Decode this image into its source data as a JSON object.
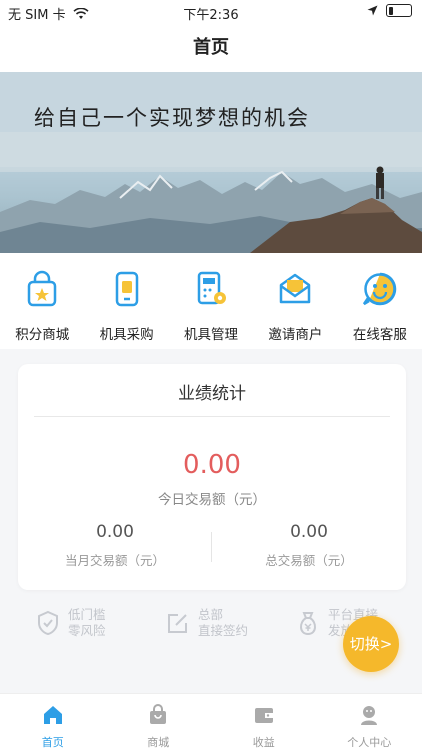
{
  "status_bar": {
    "carrier": "无 SIM 卡",
    "time": "下午2:36",
    "battery_level": 0.2
  },
  "nav": {
    "title": "首页"
  },
  "banner": {
    "slogan": "给自己一个实现梦想的机会"
  },
  "menu": [
    {
      "label": "积分商城",
      "icon": "shopping-bag-star-icon"
    },
    {
      "label": "机具采购",
      "icon": "pos-device-icon"
    },
    {
      "label": "机具管理",
      "icon": "calculator-gear-icon"
    },
    {
      "label": "邀请商户",
      "icon": "envelope-icon"
    },
    {
      "label": "在线客服",
      "icon": "smiley-face-icon"
    }
  ],
  "stats": {
    "title": "业绩统计",
    "today_value": "0.00",
    "today_label": "今日交易额（元）",
    "month_value": "0.00",
    "month_label": "当月交易额（元）",
    "total_value": "0.00",
    "total_label": "总交易额（元）"
  },
  "features": [
    {
      "line1": "低门槛",
      "line2": "零风险",
      "icon": "shield-check-icon"
    },
    {
      "line1": "总部",
      "line2": "直接签约",
      "icon": "edit-icon"
    },
    {
      "line1": "平台直接",
      "line2": "发放",
      "icon": "money-bag-icon"
    }
  ],
  "switch_button": {
    "label": "切换>"
  },
  "tabbar": [
    {
      "label": "首页",
      "icon": "home-icon",
      "active": true
    },
    {
      "label": "商城",
      "icon": "shopping-bag-icon",
      "active": false
    },
    {
      "label": "收益",
      "icon": "wallet-icon",
      "active": false
    },
    {
      "label": "个人中心",
      "icon": "profile-icon",
      "active": false
    }
  ],
  "colors": {
    "accent": "#2d9ee6",
    "highlight": "#e35d5d",
    "switch": "#f5b82b",
    "icon_yellow": "#f6c338"
  }
}
